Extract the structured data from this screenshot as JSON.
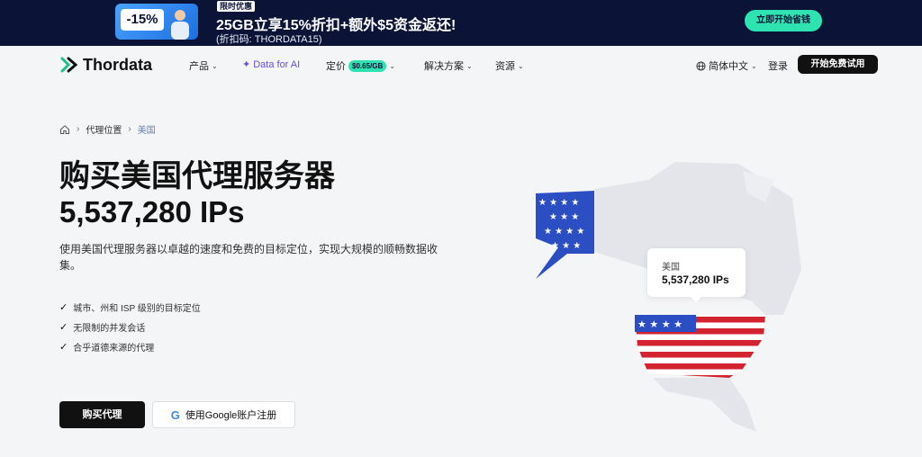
{
  "promo": {
    "discount": "-15%",
    "tag": "限时优惠",
    "title": "25GB立享15%折扣+额外$5资金返还!",
    "code": "(折扣码: THORDATA15)",
    "cta": "立即开始省钱"
  },
  "nav": {
    "brand": "Thordata",
    "items": [
      {
        "label": "产品"
      },
      {
        "label": "Data for AI"
      },
      {
        "label": "定价"
      },
      {
        "label": "解决方案"
      },
      {
        "label": "资源"
      }
    ],
    "price_badge": "$0.65/GB",
    "language": "简体中文",
    "login": "登录",
    "trial": "开始免费试用"
  },
  "breadcrumb": [
    "代理位置",
    "美国"
  ],
  "hero": {
    "title": "购买美国代理服务器",
    "ips": "5,537,280 IPs",
    "description": "使用美国代理服务器以卓越的速度和免费的目标定位，实现大规模的顺畅数据收集。",
    "features": [
      "城市、州和 ISP 级别的目标定位",
      "无限制的并发会话",
      "合乎道德来源的代理"
    ],
    "buy_button": "购买代理",
    "google_button": "使用Google账户注册"
  },
  "map": {
    "tooltip_label": "美国",
    "tooltip_value": "5,537,280 IPs"
  },
  "colors": {
    "accent": "#2fe3b1",
    "banner_bg": "#0b1437",
    "ai_purple": "#6b4bd8",
    "flag_red": "#d32230",
    "flag_blue": "#2b4fc2"
  }
}
